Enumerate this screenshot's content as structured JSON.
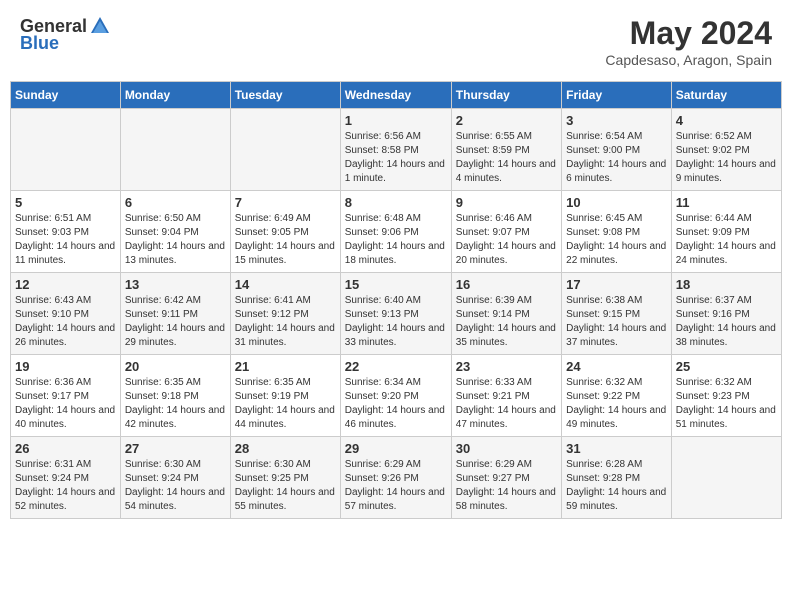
{
  "logo": {
    "general": "General",
    "blue": "Blue"
  },
  "title": "May 2024",
  "location": "Capdesaso, Aragon, Spain",
  "days_of_week": [
    "Sunday",
    "Monday",
    "Tuesday",
    "Wednesday",
    "Thursday",
    "Friday",
    "Saturday"
  ],
  "weeks": [
    [
      {
        "day": "",
        "sunrise": "",
        "sunset": "",
        "daylight": ""
      },
      {
        "day": "",
        "sunrise": "",
        "sunset": "",
        "daylight": ""
      },
      {
        "day": "",
        "sunrise": "",
        "sunset": "",
        "daylight": ""
      },
      {
        "day": "1",
        "sunrise": "Sunrise: 6:56 AM",
        "sunset": "Sunset: 8:58 PM",
        "daylight": "Daylight: 14 hours and 1 minute."
      },
      {
        "day": "2",
        "sunrise": "Sunrise: 6:55 AM",
        "sunset": "Sunset: 8:59 PM",
        "daylight": "Daylight: 14 hours and 4 minutes."
      },
      {
        "day": "3",
        "sunrise": "Sunrise: 6:54 AM",
        "sunset": "Sunset: 9:00 PM",
        "daylight": "Daylight: 14 hours and 6 minutes."
      },
      {
        "day": "4",
        "sunrise": "Sunrise: 6:52 AM",
        "sunset": "Sunset: 9:02 PM",
        "daylight": "Daylight: 14 hours and 9 minutes."
      }
    ],
    [
      {
        "day": "5",
        "sunrise": "Sunrise: 6:51 AM",
        "sunset": "Sunset: 9:03 PM",
        "daylight": "Daylight: 14 hours and 11 minutes."
      },
      {
        "day": "6",
        "sunrise": "Sunrise: 6:50 AM",
        "sunset": "Sunset: 9:04 PM",
        "daylight": "Daylight: 14 hours and 13 minutes."
      },
      {
        "day": "7",
        "sunrise": "Sunrise: 6:49 AM",
        "sunset": "Sunset: 9:05 PM",
        "daylight": "Daylight: 14 hours and 15 minutes."
      },
      {
        "day": "8",
        "sunrise": "Sunrise: 6:48 AM",
        "sunset": "Sunset: 9:06 PM",
        "daylight": "Daylight: 14 hours and 18 minutes."
      },
      {
        "day": "9",
        "sunrise": "Sunrise: 6:46 AM",
        "sunset": "Sunset: 9:07 PM",
        "daylight": "Daylight: 14 hours and 20 minutes."
      },
      {
        "day": "10",
        "sunrise": "Sunrise: 6:45 AM",
        "sunset": "Sunset: 9:08 PM",
        "daylight": "Daylight: 14 hours and 22 minutes."
      },
      {
        "day": "11",
        "sunrise": "Sunrise: 6:44 AM",
        "sunset": "Sunset: 9:09 PM",
        "daylight": "Daylight: 14 hours and 24 minutes."
      }
    ],
    [
      {
        "day": "12",
        "sunrise": "Sunrise: 6:43 AM",
        "sunset": "Sunset: 9:10 PM",
        "daylight": "Daylight: 14 hours and 26 minutes."
      },
      {
        "day": "13",
        "sunrise": "Sunrise: 6:42 AM",
        "sunset": "Sunset: 9:11 PM",
        "daylight": "Daylight: 14 hours and 29 minutes."
      },
      {
        "day": "14",
        "sunrise": "Sunrise: 6:41 AM",
        "sunset": "Sunset: 9:12 PM",
        "daylight": "Daylight: 14 hours and 31 minutes."
      },
      {
        "day": "15",
        "sunrise": "Sunrise: 6:40 AM",
        "sunset": "Sunset: 9:13 PM",
        "daylight": "Daylight: 14 hours and 33 minutes."
      },
      {
        "day": "16",
        "sunrise": "Sunrise: 6:39 AM",
        "sunset": "Sunset: 9:14 PM",
        "daylight": "Daylight: 14 hours and 35 minutes."
      },
      {
        "day": "17",
        "sunrise": "Sunrise: 6:38 AM",
        "sunset": "Sunset: 9:15 PM",
        "daylight": "Daylight: 14 hours and 37 minutes."
      },
      {
        "day": "18",
        "sunrise": "Sunrise: 6:37 AM",
        "sunset": "Sunset: 9:16 PM",
        "daylight": "Daylight: 14 hours and 38 minutes."
      }
    ],
    [
      {
        "day": "19",
        "sunrise": "Sunrise: 6:36 AM",
        "sunset": "Sunset: 9:17 PM",
        "daylight": "Daylight: 14 hours and 40 minutes."
      },
      {
        "day": "20",
        "sunrise": "Sunrise: 6:35 AM",
        "sunset": "Sunset: 9:18 PM",
        "daylight": "Daylight: 14 hours and 42 minutes."
      },
      {
        "day": "21",
        "sunrise": "Sunrise: 6:35 AM",
        "sunset": "Sunset: 9:19 PM",
        "daylight": "Daylight: 14 hours and 44 minutes."
      },
      {
        "day": "22",
        "sunrise": "Sunrise: 6:34 AM",
        "sunset": "Sunset: 9:20 PM",
        "daylight": "Daylight: 14 hours and 46 minutes."
      },
      {
        "day": "23",
        "sunrise": "Sunrise: 6:33 AM",
        "sunset": "Sunset: 9:21 PM",
        "daylight": "Daylight: 14 hours and 47 minutes."
      },
      {
        "day": "24",
        "sunrise": "Sunrise: 6:32 AM",
        "sunset": "Sunset: 9:22 PM",
        "daylight": "Daylight: 14 hours and 49 minutes."
      },
      {
        "day": "25",
        "sunrise": "Sunrise: 6:32 AM",
        "sunset": "Sunset: 9:23 PM",
        "daylight": "Daylight: 14 hours and 51 minutes."
      }
    ],
    [
      {
        "day": "26",
        "sunrise": "Sunrise: 6:31 AM",
        "sunset": "Sunset: 9:24 PM",
        "daylight": "Daylight: 14 hours and 52 minutes."
      },
      {
        "day": "27",
        "sunrise": "Sunrise: 6:30 AM",
        "sunset": "Sunset: 9:24 PM",
        "daylight": "Daylight: 14 hours and 54 minutes."
      },
      {
        "day": "28",
        "sunrise": "Sunrise: 6:30 AM",
        "sunset": "Sunset: 9:25 PM",
        "daylight": "Daylight: 14 hours and 55 minutes."
      },
      {
        "day": "29",
        "sunrise": "Sunrise: 6:29 AM",
        "sunset": "Sunset: 9:26 PM",
        "daylight": "Daylight: 14 hours and 57 minutes."
      },
      {
        "day": "30",
        "sunrise": "Sunrise: 6:29 AM",
        "sunset": "Sunset: 9:27 PM",
        "daylight": "Daylight: 14 hours and 58 minutes."
      },
      {
        "day": "31",
        "sunrise": "Sunrise: 6:28 AM",
        "sunset": "Sunset: 9:28 PM",
        "daylight": "Daylight: 14 hours and 59 minutes."
      },
      {
        "day": "",
        "sunrise": "",
        "sunset": "",
        "daylight": ""
      }
    ]
  ]
}
